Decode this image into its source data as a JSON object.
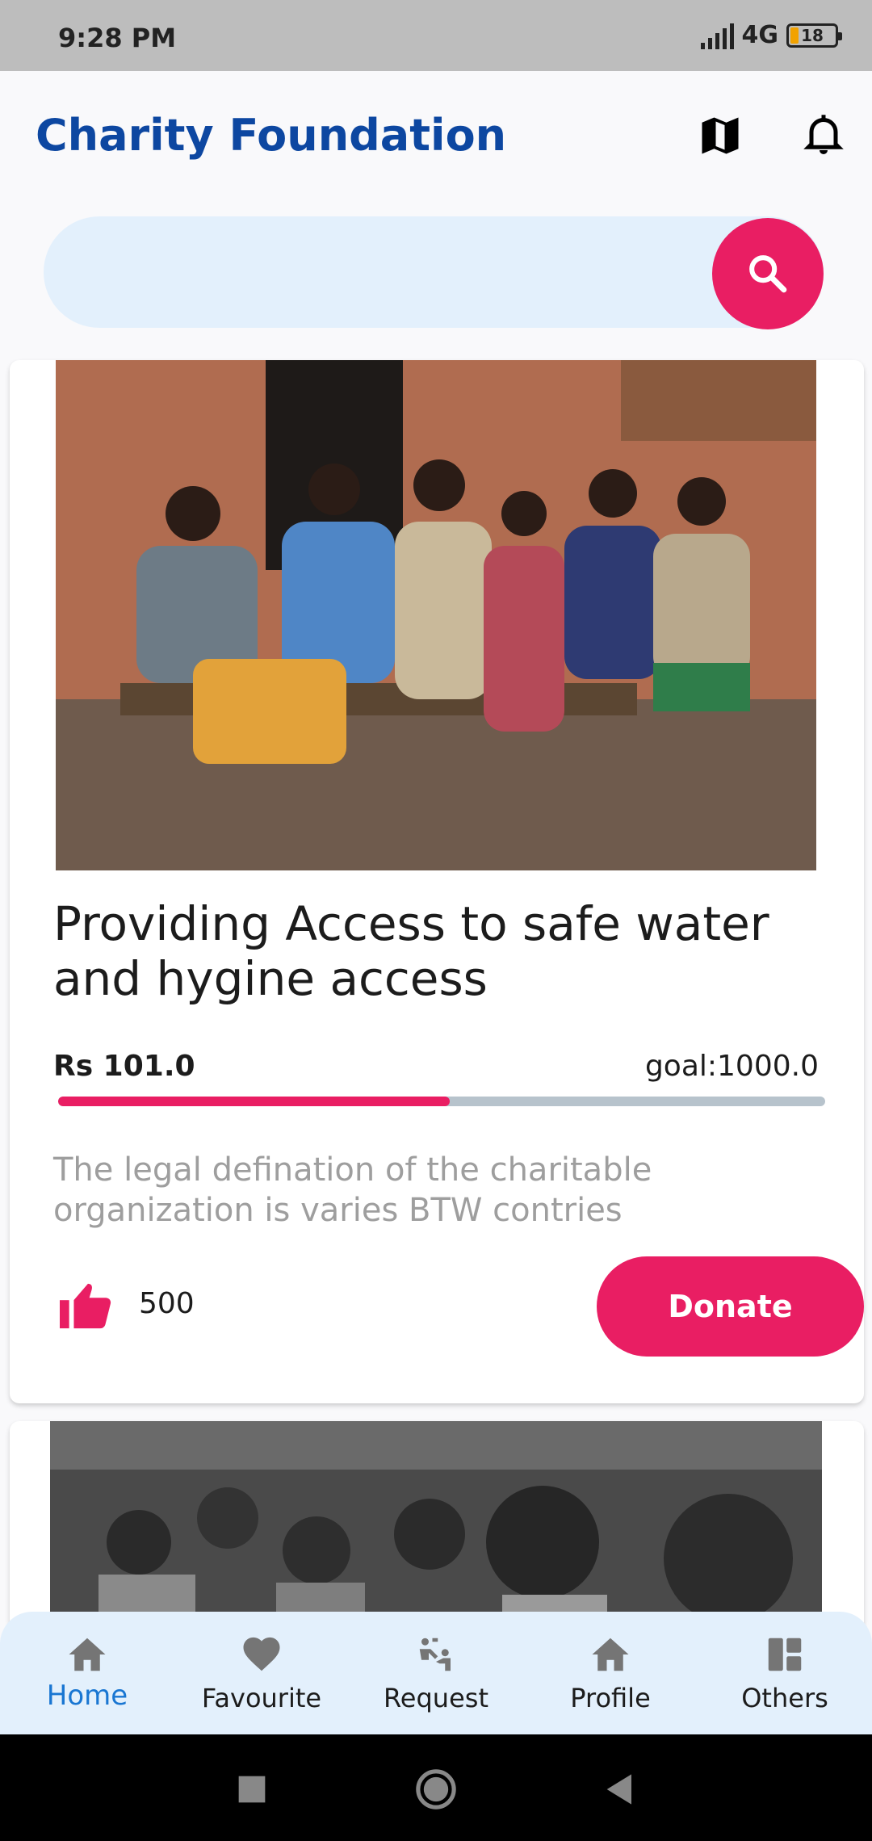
{
  "status_bar": {
    "time": "9:28 PM",
    "network": "4G",
    "battery": "18"
  },
  "app_bar": {
    "title": "Charity Foundation",
    "map_icon": "map-icon",
    "bell_icon": "bell-icon"
  },
  "search": {
    "placeholder": "",
    "value": "",
    "button_icon": "search-icon"
  },
  "cards": [
    {
      "title": "Providing Access to safe water and hygine access",
      "raised": "Rs 101.0",
      "goal": "goal:1000.0",
      "progress": 0.51,
      "description": "The legal defination of the charitable organization is varies BTW contries",
      "likes": "500",
      "donate_label": "Donate"
    }
  ],
  "bottom_nav": [
    {
      "label": "Home",
      "icon": "home-icon",
      "active": true
    },
    {
      "label": "Favourite",
      "icon": "heart-icon",
      "active": false
    },
    {
      "label": "Request",
      "icon": "request-icon",
      "active": false
    },
    {
      "label": "Profile",
      "icon": "home-icon",
      "active": false
    },
    {
      "label": "Others",
      "icon": "dashboard-icon",
      "active": false
    }
  ],
  "colors": {
    "brand": "#0d47a1",
    "accent": "#e91e63",
    "search_bg": "#e3f0fc",
    "nav_active": "#1976d2"
  }
}
